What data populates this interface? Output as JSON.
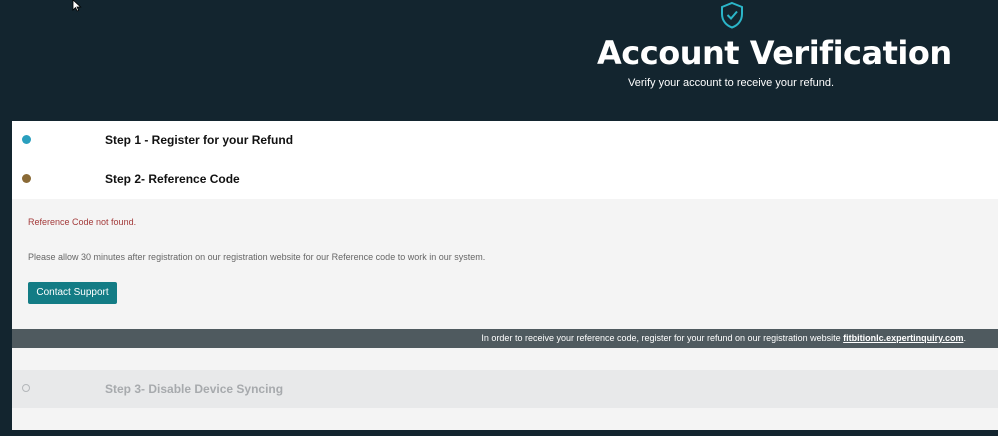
{
  "hero": {
    "title": "Account Verification",
    "subtitle": "Verify your account to receive your refund."
  },
  "steps": [
    {
      "label": "Step 1 - Register for your Refund",
      "status": "complete"
    },
    {
      "label": "Step 2- Reference Code",
      "status": "error"
    },
    {
      "label": "Step 3- Disable Device Syncing",
      "status": "pending"
    }
  ],
  "step2_content": {
    "error_message": "Reference Code not found.",
    "info_message": "Please allow 30 minutes after registration on our registration website for our Reference code to work in our system.",
    "contact_button": "Contact Support"
  },
  "info_bar": {
    "text": "In order to receive your reference code, register for your refund on our registration website",
    "link": "fitbitionlc.expertinquiry.com",
    "suffix": "."
  },
  "colors": {
    "header_bg": "#13252f",
    "accent": "#137c85",
    "error": "#a33a3a"
  }
}
